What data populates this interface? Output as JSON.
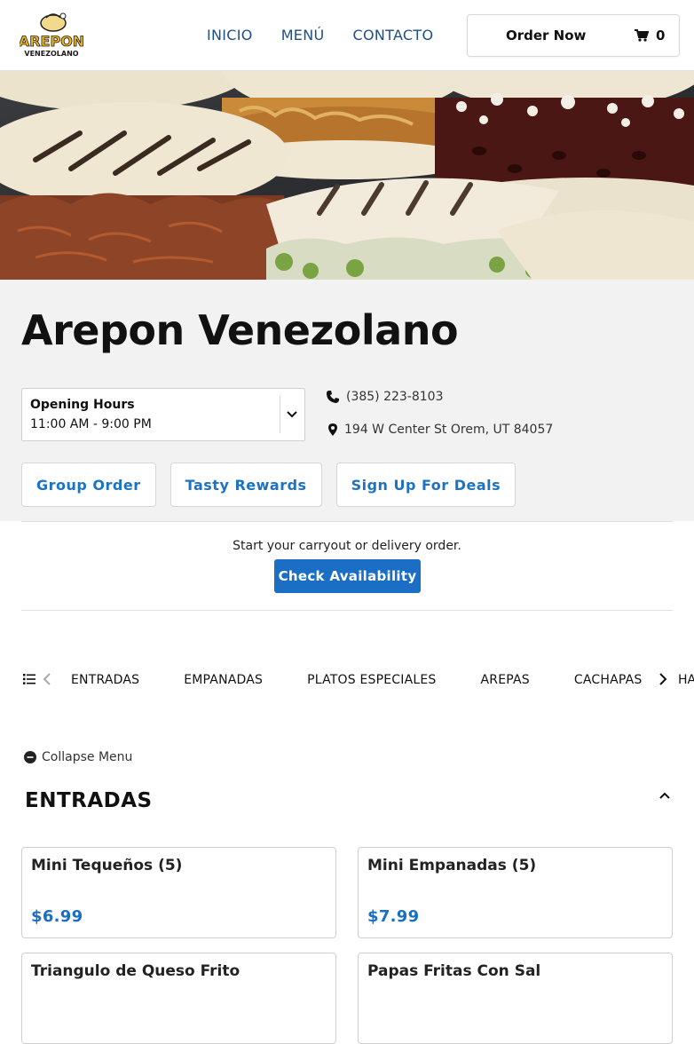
{
  "header": {
    "logo_text_top": "AREPON",
    "logo_text_bottom": "VENEZOLANO",
    "nav": [
      "INICIO",
      "MENÚ",
      "CONTACTO"
    ],
    "order_label": "Order Now",
    "cart_count": "0"
  },
  "restaurant": {
    "name": "Arepon Venezolano",
    "hours_title": "Opening Hours",
    "hours_value": "11:00 AM - 9:00 PM",
    "phone": "(385) 223-8103",
    "address": "194 W Center St Orem, UT 84057"
  },
  "actions": [
    "Group Order",
    "Tasty Rewards",
    "Sign Up For Deals"
  ],
  "availability": {
    "prompt": "Start your carryout or delivery order.",
    "button": "Check Availability"
  },
  "categories": [
    "ENTRADAS",
    "EMPANADAS",
    "PLATOS ESPECIALES",
    "AREPAS",
    "CACHAPAS"
  ],
  "category_overflow": "HA",
  "collapse_label": "Collapse Menu",
  "section": {
    "title": "ENTRADAS",
    "items": [
      {
        "name": "Mini Tequeños (5)",
        "price": "$6.99"
      },
      {
        "name": "Mini Empanadas (5)",
        "price": "$7.99"
      },
      {
        "name": "Triangulo de Queso Frito",
        "price": ""
      },
      {
        "name": "Papas Fritas Con Sal",
        "price": ""
      }
    ]
  },
  "colors": {
    "accent": "#1a6fc4",
    "nav": "#1d4e89",
    "band": "#f2f2f2"
  }
}
